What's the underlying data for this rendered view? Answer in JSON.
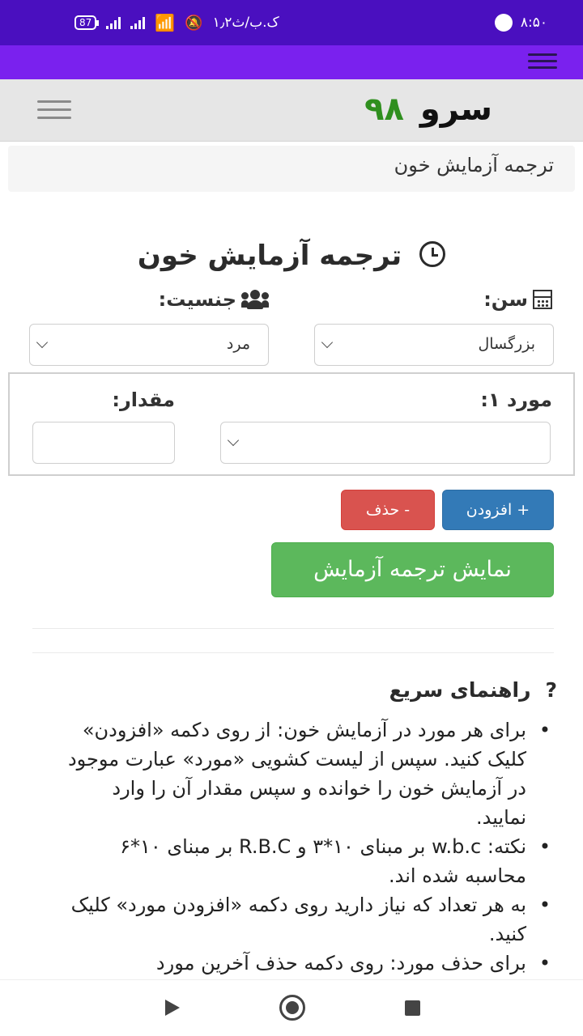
{
  "status_bar": {
    "time": "۸:۵۰",
    "speed": "۱٫۲ک.ب/ث",
    "battery": "87"
  },
  "site": {
    "logo_text": "سرو",
    "logo_number": "۹۸"
  },
  "breadcrumb": {
    "current": "ترجمه آزمایش خون"
  },
  "form": {
    "title": "ترجمه آزمایش خون",
    "age_label": "سن:",
    "age_value": "بزرگسال",
    "gender_label": "جنسیت:",
    "gender_value": "مرد",
    "item_label": "مورد ۱:",
    "item_value": "",
    "amount_label": "مقدار:",
    "amount_value": ""
  },
  "buttons": {
    "add": "+ افزودن",
    "delete": "- حذف",
    "show": "نمایش ترجمه آزمایش"
  },
  "guide": {
    "icon": "?",
    "title": "راهنمای سریع",
    "items": [
      "برای هر مورد در آزمایش خون: از روی دکمه «افزودن» کلیک کنید. سپس از لیست کشویی «مورد» عبارت موجود در آزمایش خون را خوانده و سپس مقدار آن را وارد نمایید.",
      "نکته: w.b.c بر مبنای ۱۰*۳ و R.B.C بر مبنای ۱۰*۶ محاسبه شده اند.",
      "به هر تعداد که نیاز دارید روی دکمه «افزودن مورد» کلیک کنید.",
      "برای حذف مورد: روی دکمه حذف آخرین مورد"
    ]
  },
  "icons": {
    "age": "calculator-icon",
    "gender": "users-icon",
    "title": "clock-icon",
    "menu": "hamburger-icon"
  },
  "colors": {
    "status_bar": "#4a0fbf",
    "app_bar": "#7a21ee",
    "add_button": "#337ab7",
    "delete_button": "#d9534f",
    "show_button": "#5cb85c",
    "logo_number": "#2f8f1e"
  }
}
